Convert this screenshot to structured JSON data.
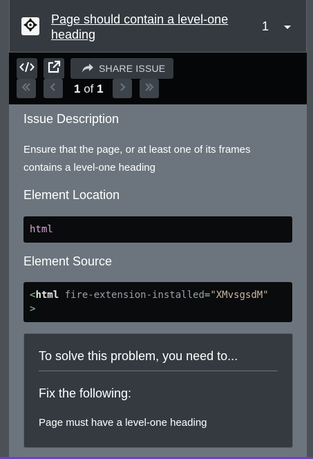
{
  "issue": {
    "title": "Page should contain a level-one heading",
    "count": "1"
  },
  "toolbar": {
    "share_label": "SHARE ISSUE"
  },
  "pager": {
    "current": "1",
    "of_label": "of",
    "total": "1"
  },
  "description": {
    "heading": "Issue Description",
    "text": "Ensure that the page, or at least one of its frames contains a level-one heading"
  },
  "location": {
    "heading": "Element Location",
    "selector": "html"
  },
  "source": {
    "heading": "Element Source",
    "open_bracket": "<",
    "tag": "html",
    "attr_name": "fire-extension-installed",
    "equals": "=",
    "attr_value": "\"XMvsgsdM\"",
    "close_bracket": ">"
  },
  "solution": {
    "heading": "To solve this problem, you need to...",
    "fix_heading": "Fix the following:",
    "fix_item": "Page must have a level-one heading"
  },
  "colors": {
    "panel_bg": "#6c757d",
    "header_bg": "#343a40",
    "toolbar_bg": "#050607",
    "accent": "#6f42c1"
  },
  "icons": [
    "crosshair-locate-icon",
    "chevron-down-icon",
    "code-icon",
    "external-link-icon",
    "share-icon",
    "double-chevron-left-icon",
    "chevron-left-icon",
    "chevron-right-icon",
    "double-chevron-right-icon"
  ]
}
